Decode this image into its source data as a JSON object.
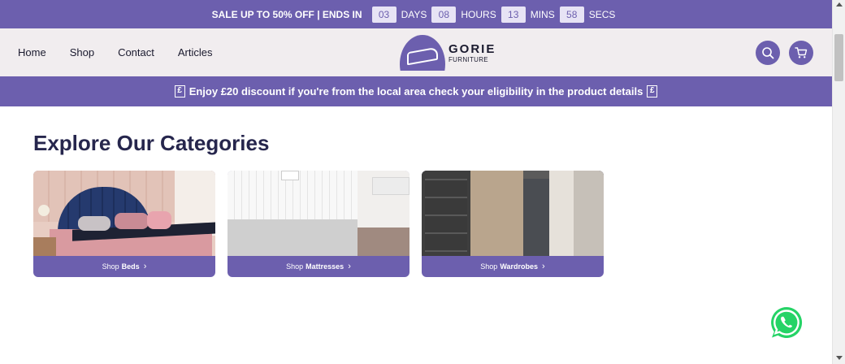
{
  "sale_bar": {
    "text": "SALE UP TO 50% OFF | ENDS IN",
    "countdown": [
      {
        "value": "03",
        "unit": "DAYS"
      },
      {
        "value": "08",
        "unit": "HOURS"
      },
      {
        "value": "13",
        "unit": "MINS"
      },
      {
        "value": "58",
        "unit": "SECS"
      }
    ]
  },
  "nav": {
    "items": [
      "Home",
      "Shop",
      "Contact",
      "Articles"
    ]
  },
  "logo": {
    "name": "GORIE",
    "sub": "FURNITURE"
  },
  "header_icons": [
    "search-icon",
    "cart-icon"
  ],
  "promo": {
    "symbol_left": "£",
    "text": "Enjoy £20 discount if you're from the local area check your eligibility in the product details",
    "symbol_right": "£"
  },
  "main": {
    "title": "Explore Our Categories",
    "categories": [
      {
        "prefix": "Shop",
        "name": "Beds",
        "chevron": "›"
      },
      {
        "prefix": "Shop",
        "name": "Mattresses",
        "chevron": "›"
      },
      {
        "prefix": "Shop",
        "name": "Wardrobes",
        "chevron": "›"
      }
    ]
  },
  "colors": {
    "brand": "#6c5fae",
    "header_bg": "#f1edef",
    "title": "#26264d",
    "whatsapp": "#25d366"
  }
}
